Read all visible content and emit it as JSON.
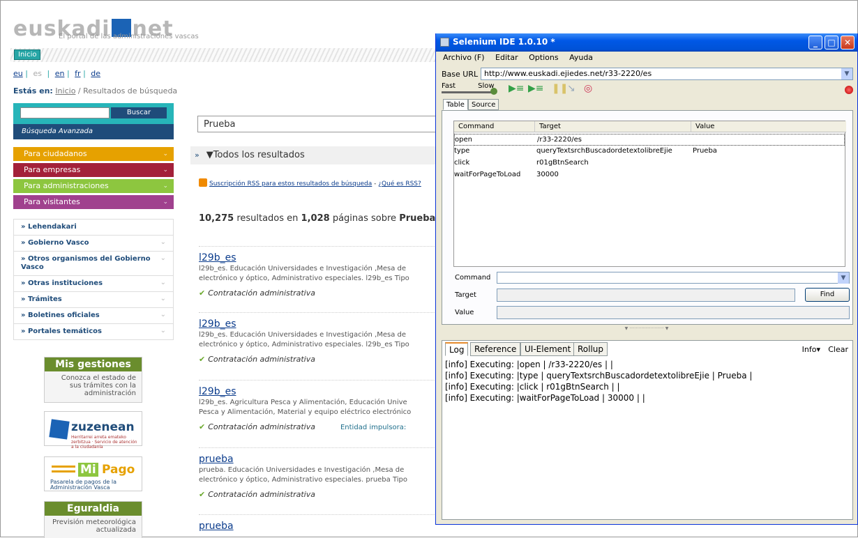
{
  "site": {
    "logo_text_left": "euskadi",
    "logo_text_right": "net",
    "tagline": "El portal de las administraciones vascas",
    "inicio_button": "Inicio",
    "languages": [
      {
        "code": "eu",
        "enabled": true
      },
      {
        "code": "es",
        "enabled": false
      },
      {
        "code": "en",
        "enabled": true
      },
      {
        "code": "fr",
        "enabled": true
      },
      {
        "code": "de",
        "enabled": true
      }
    ],
    "breadcrumb": {
      "label": "Estás en:",
      "home": "Inicio",
      "current": "Resultados de búsqueda"
    },
    "search": {
      "button": "Buscar",
      "advanced": "Búsqueda Avanzada"
    },
    "categories": [
      "Para ciudadanos",
      "Para empresas",
      "Para administraciones",
      "Para visitantes"
    ],
    "sublinks": [
      "Lehendakari",
      "Gobierno Vasco",
      "Otros organismos del Gobierno Vasco",
      "Otras instituciones",
      "Trámites",
      "Boletines oficiales",
      "Portales temáticos"
    ],
    "promos": {
      "mis_gestiones": {
        "title": "Mis gestiones",
        "body": "Conozca el estado de sus trámites con la administración"
      },
      "zuzenean": {
        "title": "zuzenean",
        "sub": "Herritarrei arreta emateko zerbitzua · Servicio de atención a la ciudadanía"
      },
      "mipago": {
        "mi": "Mi",
        "pago": "Pago",
        "sub": "Pasarela de pagos de la Administración Vasca"
      },
      "eguraldia": {
        "title": "Eguraldia",
        "body": "Previsión meteorológica actualizada"
      }
    },
    "query": "Prueba",
    "filter": "Todos los resultados",
    "rss": {
      "link": "Suscripción RSS para estos resultados de búsqueda",
      "sep": " - ",
      "what": "¿Qué es RSS?"
    },
    "count": {
      "n": "10,275",
      "t1": "resultados en",
      "pages": "1,028",
      "t2": "páginas sobre",
      "q": "Prueba"
    },
    "results": [
      {
        "title": "l29b_es",
        "desc1": "l29b_es. Educación Universidades e Investigación ,Mesa de",
        "desc2": "electrónico y óptico, Administrativo especiales. l29b_es Tipo",
        "category": "Contratación administrativa",
        "extra": ""
      },
      {
        "title": "l29b_es",
        "desc1": "l29b_es. Educación Universidades e Investigación ,Mesa de",
        "desc2": "electrónico y óptico, Administrativo especiales. l29b_es Tipo",
        "category": "Contratación administrativa",
        "extra": ""
      },
      {
        "title": "l29b_es",
        "desc1": "l29b_es. Agricultura Pesca y Alimentación, Educación Unive",
        "desc2": "Pesca y Alimentación, Material y equipo eléctrico electrónico",
        "category": "Contratación administrativa",
        "extra": "Entidad impulsora:"
      },
      {
        "title": "prueba",
        "desc1": "prueba. Educación Universidades e Investigación ,Mesa de",
        "desc2": "electrónico y óptico, Administrativo especiales. prueba Tipo",
        "category": "Contratación administrativa",
        "extra": ""
      },
      {
        "title": "prueba",
        "desc1": "",
        "desc2": "",
        "category": "",
        "extra": ""
      }
    ]
  },
  "ide": {
    "title": "Selenium IDE 1.0.10 *",
    "menu": [
      "Archivo (F)",
      "Editar",
      "Options",
      "Ayuda"
    ],
    "base_url_label": "Base URL",
    "base_url": "http://www.euskadi.ejiedes.net/r33-2220/es",
    "speed_fast": "Fast",
    "speed_slow": "Slow",
    "tabs": [
      "Table",
      "Source"
    ],
    "columns": [
      "Command",
      "Target",
      "Value"
    ],
    "rows": [
      {
        "command": "open",
        "target": "/r33-2220/es",
        "value": ""
      },
      {
        "command": "type",
        "target": "queryTextsrchBuscadordetextolibreEjie",
        "value": "Prueba"
      },
      {
        "command": "click",
        "target": "r01gBtnSearch",
        "value": ""
      },
      {
        "command": "waitForPageToLoad",
        "target": "30000",
        "value": ""
      }
    ],
    "field_labels": {
      "command": "Command",
      "target": "Target",
      "value": "Value"
    },
    "find_button": "Find",
    "log_tabs": [
      "Log",
      "Reference",
      "UI-Element",
      "Rollup"
    ],
    "info_dropdown": "Info▾",
    "clear": "Clear",
    "log_lines": [
      "[info] Executing: |open | /r33-2220/es | |",
      "[info] Executing: |type | queryTextsrchBuscadordetextolibreEjie | Prueba |",
      "[info] Executing: |click | r01gBtnSearch | |",
      "[info] Executing: |waitForPageToLoad | 30000 | |"
    ]
  }
}
